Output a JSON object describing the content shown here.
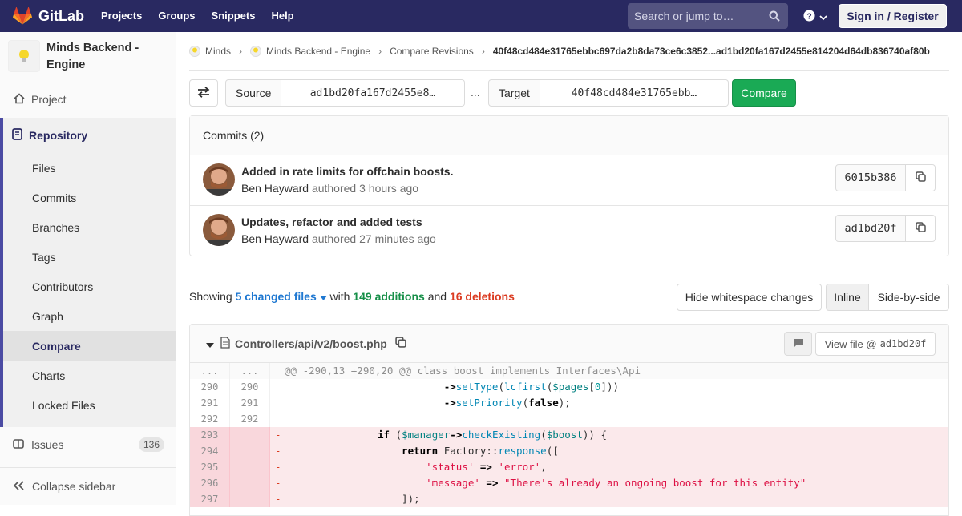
{
  "navbar": {
    "brand": "GitLab",
    "links": [
      "Projects",
      "Groups",
      "Snippets",
      "Help"
    ],
    "search_placeholder": "Search or jump to…",
    "signin_label": "Sign in / Register",
    "icons": [
      "gitlab-logo-icon",
      "search-icon",
      "help-icon",
      "chevron-down-icon"
    ]
  },
  "sidebar": {
    "project_name": "Minds Backend - Engine",
    "project": "Project",
    "repository": "Repository",
    "sub_items": [
      "Files",
      "Commits",
      "Branches",
      "Tags",
      "Contributors",
      "Graph",
      "Compare",
      "Charts",
      "Locked Files"
    ],
    "active_item": "Compare",
    "issues_label": "Issues",
    "issues_count": "136",
    "collapse_label": "Collapse sidebar"
  },
  "breadcrumb": {
    "group": "Minds",
    "project": "Minds Backend - Engine",
    "section": "Compare Revisions",
    "current": "40f48cd484e31765ebbc697da2b8da73ce6c3852...ad1bd20fa167d2455e814204d64db836740af80b"
  },
  "compare": {
    "source_label": "Source",
    "source_value": "ad1bd20fa167d2455e8…",
    "dots": "...",
    "target_label": "Target",
    "target_value": "40f48cd484e31765ebb…",
    "compare_label": "Compare"
  },
  "commits": {
    "header": "Commits (2)",
    "items": [
      {
        "title": "Added in rate limits for offchain boosts.",
        "author": "Ben Hayward",
        "verb": "authored",
        "time": "3 hours ago",
        "sha": "6015b386"
      },
      {
        "title": "Updates, refactor and added tests",
        "author": "Ben Hayward",
        "verb": "authored",
        "time": "27 minutes ago",
        "sha": "ad1bd20f"
      }
    ]
  },
  "diffstats": {
    "showing": "Showing",
    "files": "5 changed files",
    "with": "with",
    "additions": "149 additions",
    "and": "and",
    "deletions": "16 deletions",
    "hide_whitespace": "Hide whitespace changes",
    "inline": "Inline",
    "side_by_side": "Side-by-side"
  },
  "file": {
    "path": "Controllers/api/v2/boost.php",
    "view_file_label": "View file @",
    "view_file_sha": "ad1bd20f",
    "lines": [
      {
        "type": "meta",
        "old": "...",
        "new": "...",
        "code": "@@ -290,13 +290,20 @@ class boost implements Interfaces\\Api"
      },
      {
        "type": "ctx",
        "old": "290",
        "new": "290",
        "code": "                            ->setType(lcfirst($pages[0]))"
      },
      {
        "type": "ctx",
        "old": "291",
        "new": "291",
        "code": "                            ->setPriority(false);"
      },
      {
        "type": "ctx",
        "old": "292",
        "new": "292",
        "code": ""
      },
      {
        "type": "old",
        "old": "293",
        "new": "",
        "code": "-                if ($manager->checkExisting($boost)) {"
      },
      {
        "type": "old",
        "old": "294",
        "new": "",
        "code": "-                    return Factory::response(["
      },
      {
        "type": "old",
        "old": "295",
        "new": "",
        "code": "-                        'status' => 'error',"
      },
      {
        "type": "old",
        "old": "296",
        "new": "",
        "code": "-                        'message' => \"There's already an ongoing boost for this entity\""
      },
      {
        "type": "old",
        "old": "297",
        "new": "",
        "code": "-                    ]);"
      }
    ]
  },
  "colors": {
    "navbar": "#292961",
    "accent": "#1f78d1",
    "success": "#1aaa55",
    "additions": "#168f48",
    "deletions": "#db3b21"
  }
}
